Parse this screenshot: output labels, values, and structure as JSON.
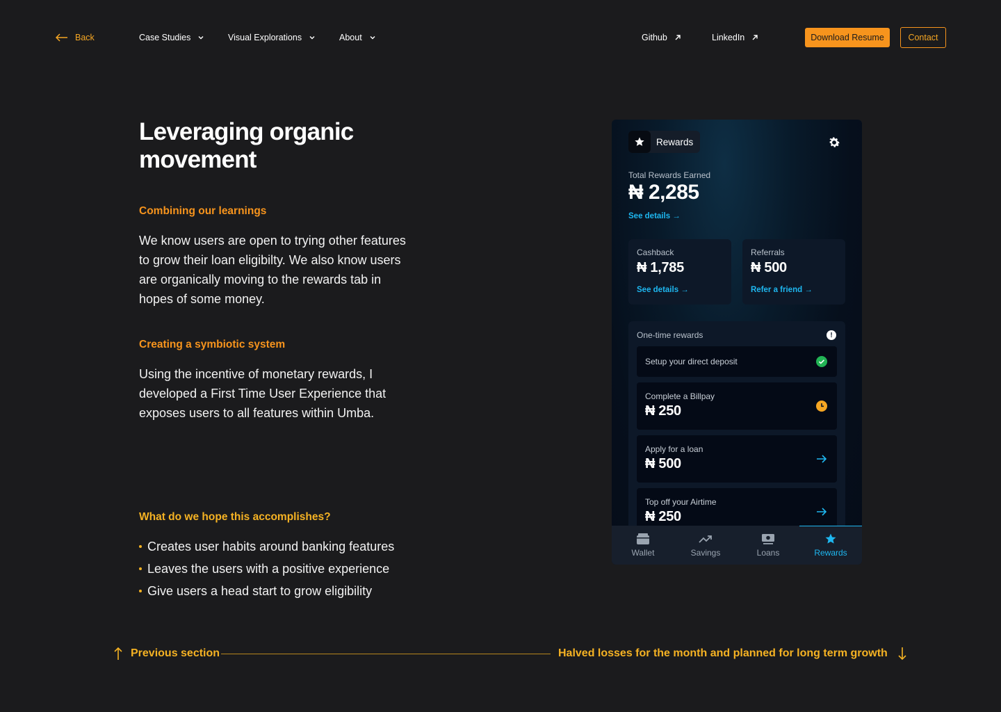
{
  "nav": {
    "back_label": "Back",
    "case_studies": "Case Studies",
    "visual_explorations": "Visual Explorations",
    "about": "About",
    "github": "Github",
    "linkedin": "LinkedIn",
    "download_resume": "Download Resume",
    "contact": "Contact"
  },
  "main": {
    "title": "Leveraging organic movement",
    "section1_heading": "Combining our learnings",
    "section1_body": "We know users are open to trying other features to grow their loan eligibilty. We also know users are organically moving to the rewards tab in hopes of some money.",
    "section2_heading": "Creating a symbiotic system",
    "section2_body": "Using the incentive of monetary rewards, I developed a First Time User Experience that exposes users to all features within Umba.",
    "goals_heading": "What do we hope this accomplishes?",
    "goals": [
      "Creates user habits around banking features",
      "Leaves the users with a positive experience",
      "Give users a head start to grow eligibility"
    ]
  },
  "phone": {
    "header_label": "Rewards",
    "total_label": "Total Rewards Earned",
    "total_value": "₦ 2,285",
    "total_link": "See details →",
    "cashback_label": "Cashback",
    "cashback_value": "₦ 1,785",
    "cashback_link": "See details →",
    "referrals_label": "Referrals",
    "referrals_value": "₦ 500",
    "referrals_link": "Refer a friend →",
    "one_time_title": "One-time rewards",
    "tasks": [
      {
        "title": "Setup your direct deposit",
        "amount": "",
        "status": "complete"
      },
      {
        "title": "Complete a Billpay",
        "amount": "₦ 250",
        "status": "pending"
      },
      {
        "title": "Apply for a loan",
        "amount": "₦ 500",
        "status": "open"
      },
      {
        "title": "Top off your Airtime",
        "amount": "₦ 250",
        "status": "open"
      }
    ],
    "tabs": [
      "Wallet",
      "Savings",
      "Loans",
      "Rewards"
    ],
    "active_tab": "Rewards",
    "accent_color": "#1eb7f0"
  },
  "footer": {
    "previous": "Previous section",
    "next": "Halved losses for the month and planned for long term growth"
  },
  "colors": {
    "background": "#1b1b1d",
    "orange": "#f7941d",
    "gold": "#f5b223"
  }
}
